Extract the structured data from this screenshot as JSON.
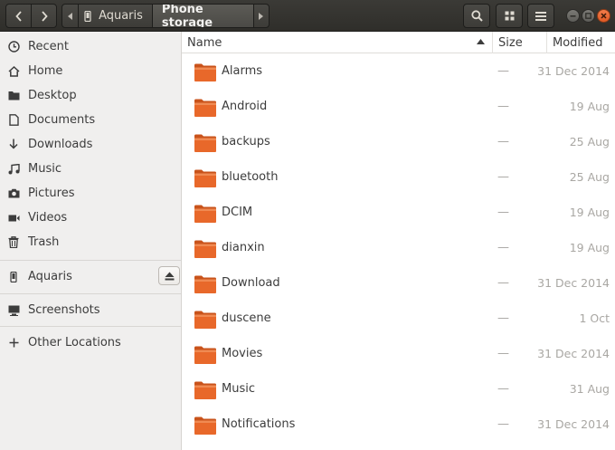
{
  "header": {
    "back_icon": "chevron-left-icon",
    "forward_icon": "chevron-right-icon",
    "path": [
      "Aquaris",
      "Phone storage"
    ],
    "search_icon": "search-icon",
    "view_icon": "grid-view-icon",
    "menu_icon": "hamburger-menu-icon"
  },
  "sidebar": {
    "places": [
      {
        "label": "Recent",
        "icon": "clock-icon"
      },
      {
        "label": "Home",
        "icon": "home-icon"
      },
      {
        "label": "Desktop",
        "icon": "folder-icon"
      },
      {
        "label": "Documents",
        "icon": "document-icon"
      },
      {
        "label": "Downloads",
        "icon": "download-icon"
      },
      {
        "label": "Music",
        "icon": "music-icon"
      },
      {
        "label": "Pictures",
        "icon": "camera-icon"
      },
      {
        "label": "Videos",
        "icon": "video-icon"
      },
      {
        "label": "Trash",
        "icon": "trash-icon"
      }
    ],
    "devices": [
      {
        "label": "Aquaris",
        "icon": "phone-icon"
      }
    ],
    "bookmarks": [
      {
        "label": "Screenshots",
        "icon": "monitor-icon"
      }
    ],
    "other": [
      {
        "label": "Other Locations",
        "icon": "plus-icon"
      }
    ]
  },
  "columns": {
    "name": "Name",
    "size": "Size",
    "modified": "Modified"
  },
  "files": [
    {
      "name": "Alarms",
      "size": "—",
      "modified": "31 Dec 2014"
    },
    {
      "name": "Android",
      "size": "—",
      "modified": "19 Aug"
    },
    {
      "name": "backups",
      "size": "—",
      "modified": "25 Aug"
    },
    {
      "name": "bluetooth",
      "size": "—",
      "modified": "25 Aug"
    },
    {
      "name": "DCIM",
      "size": "—",
      "modified": "19 Aug"
    },
    {
      "name": "dianxin",
      "size": "—",
      "modified": "19 Aug"
    },
    {
      "name": "Download",
      "size": "—",
      "modified": "31 Dec 2014"
    },
    {
      "name": "duscene",
      "size": "—",
      "modified": "1 Oct"
    },
    {
      "name": "Movies",
      "size": "—",
      "modified": "31 Dec 2014"
    },
    {
      "name": "Music",
      "size": "—",
      "modified": "31 Aug"
    },
    {
      "name": "Notifications",
      "size": "—",
      "modified": "31 Dec 2014"
    }
  ],
  "colors": {
    "folder": "#e8682a",
    "header_bg": "#3b3a36",
    "close_button": "#f27c4a"
  }
}
